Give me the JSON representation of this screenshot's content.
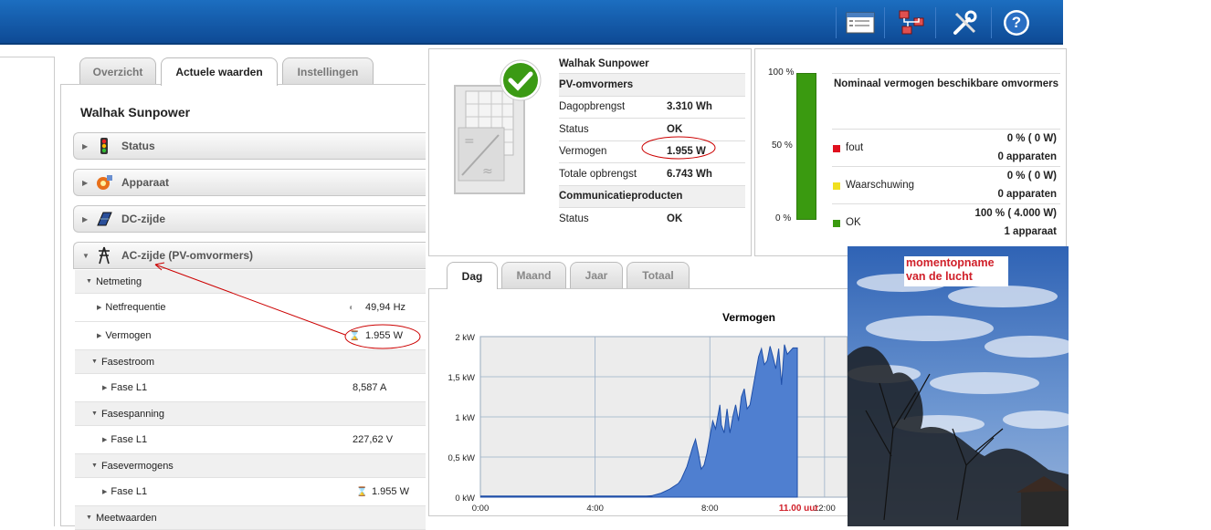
{
  "toolbar": {
    "icons": [
      "window-icon",
      "network-icon",
      "tools-icon",
      "help-icon"
    ],
    "help_glyph": "?"
  },
  "tabs": [
    "Overzicht",
    "Actuele waarden",
    "Instellingen"
  ],
  "page_title": "Walhak Sunpower",
  "accordion": [
    {
      "label": "Status",
      "icon": "traffic-light-icon"
    },
    {
      "label": "Apparaat",
      "icon": "device-icon"
    },
    {
      "label": "DC-zijde",
      "icon": "solar-panel-icon"
    },
    {
      "label": "AC-zijde  (PV-omvormers)",
      "icon": "power-pylon-icon"
    }
  ],
  "ac_rows": {
    "netmeting": "Netmeting",
    "netfrequentie": {
      "label": "Netfrequentie",
      "value": "49,94  Hz"
    },
    "vermogen": {
      "label": "Vermogen",
      "value": "1.955  W"
    },
    "fasestroom": "Fasestroom",
    "fasestroom_l1": {
      "label": "Fase L1",
      "value": "8,587  A"
    },
    "fasespanning": "Fasespanning",
    "fasespanning_l1": {
      "label": "Fase L1",
      "value": "227,62  V"
    },
    "fasevermogens": "Fasevermogens",
    "fasevermogens_l1": {
      "label": "Fase L1",
      "value": "1.955  W"
    },
    "meetwaarden": "Meetwaarden"
  },
  "status_card": {
    "name": "Walhak Sunpower",
    "section1": "PV-omvormers",
    "rows": [
      {
        "label": "Dagopbrengst",
        "value": "3.310  Wh"
      },
      {
        "label": "Status",
        "value": "OK"
      },
      {
        "label": "Vermogen",
        "value": "1.955  W"
      },
      {
        "label": "Totale opbrengst",
        "value": "6.743  Wh"
      }
    ],
    "section2": "Communicatieproducten",
    "comm_status": {
      "label": "Status",
      "value": "OK"
    }
  },
  "capacity_card": {
    "title": "Nominaal vermogen beschikbare omvormers",
    "yticks": [
      "100 %",
      "50 %",
      "0 %"
    ],
    "bar_fraction": 1.0,
    "rows": [
      {
        "name": "fout",
        "color": "#e0101e",
        "pct": "0 %  ( 0 W)",
        "count": "0 apparaten"
      },
      {
        "name": "Waarschuwing",
        "color": "#f0e020",
        "pct": "0 %  ( 0 W)",
        "count": "0 apparaten"
      },
      {
        "name": "OK",
        "color": "#3a9a10",
        "pct": "100 %  ( 4.000 W)",
        "count": "1 apparaat"
      }
    ]
  },
  "chart_tabs": [
    "Dag",
    "Maand",
    "Jaar",
    "Totaal"
  ],
  "chart_data": {
    "type": "area",
    "title": "Vermogen",
    "x_unit": "hours",
    "xticks": [
      "0:00",
      "4:00",
      "8:00",
      "12:00"
    ],
    "x_marker_label": "11.00 uur",
    "yticks": [
      "0 kW",
      "0,5 kW",
      "1 kW",
      "1,5 kW",
      "2 kW"
    ],
    "ylim": [
      0,
      2
    ],
    "xlim": [
      0,
      12.8
    ],
    "color": "#4f7fd0",
    "x": [
      0,
      5.5,
      6.0,
      6.3,
      6.6,
      6.9,
      7.0,
      7.1,
      7.2,
      7.3,
      7.4,
      7.5,
      7.6,
      7.7,
      7.8,
      7.9,
      8.0,
      8.1,
      8.2,
      8.3,
      8.35,
      8.4,
      8.5,
      8.55,
      8.6,
      8.7,
      8.8,
      8.9,
      9.0,
      9.1,
      9.2,
      9.3,
      9.4,
      9.5,
      9.6,
      9.7,
      9.8,
      9.9,
      10.0,
      10.1,
      10.2,
      10.3,
      10.4,
      10.5,
      10.6,
      10.7,
      10.8,
      10.9,
      11.0,
      11.05
    ],
    "y": [
      0,
      0,
      0.02,
      0.05,
      0.1,
      0.17,
      0.22,
      0.3,
      0.38,
      0.5,
      0.62,
      0.72,
      0.55,
      0.35,
      0.4,
      0.55,
      0.75,
      0.95,
      0.85,
      1.05,
      1.15,
      0.9,
      0.8,
      0.95,
      1.1,
      0.8,
      1.0,
      1.15,
      0.95,
      1.25,
      1.35,
      1.1,
      1.15,
      1.35,
      1.55,
      1.75,
      1.85,
      1.65,
      1.7,
      1.88,
      1.75,
      1.6,
      1.85,
      1.4,
      1.9,
      1.78,
      1.82,
      1.86,
      1.86,
      1.86
    ]
  },
  "photo": {
    "label_line1": "momentopname",
    "label_line2": "van de lucht"
  }
}
